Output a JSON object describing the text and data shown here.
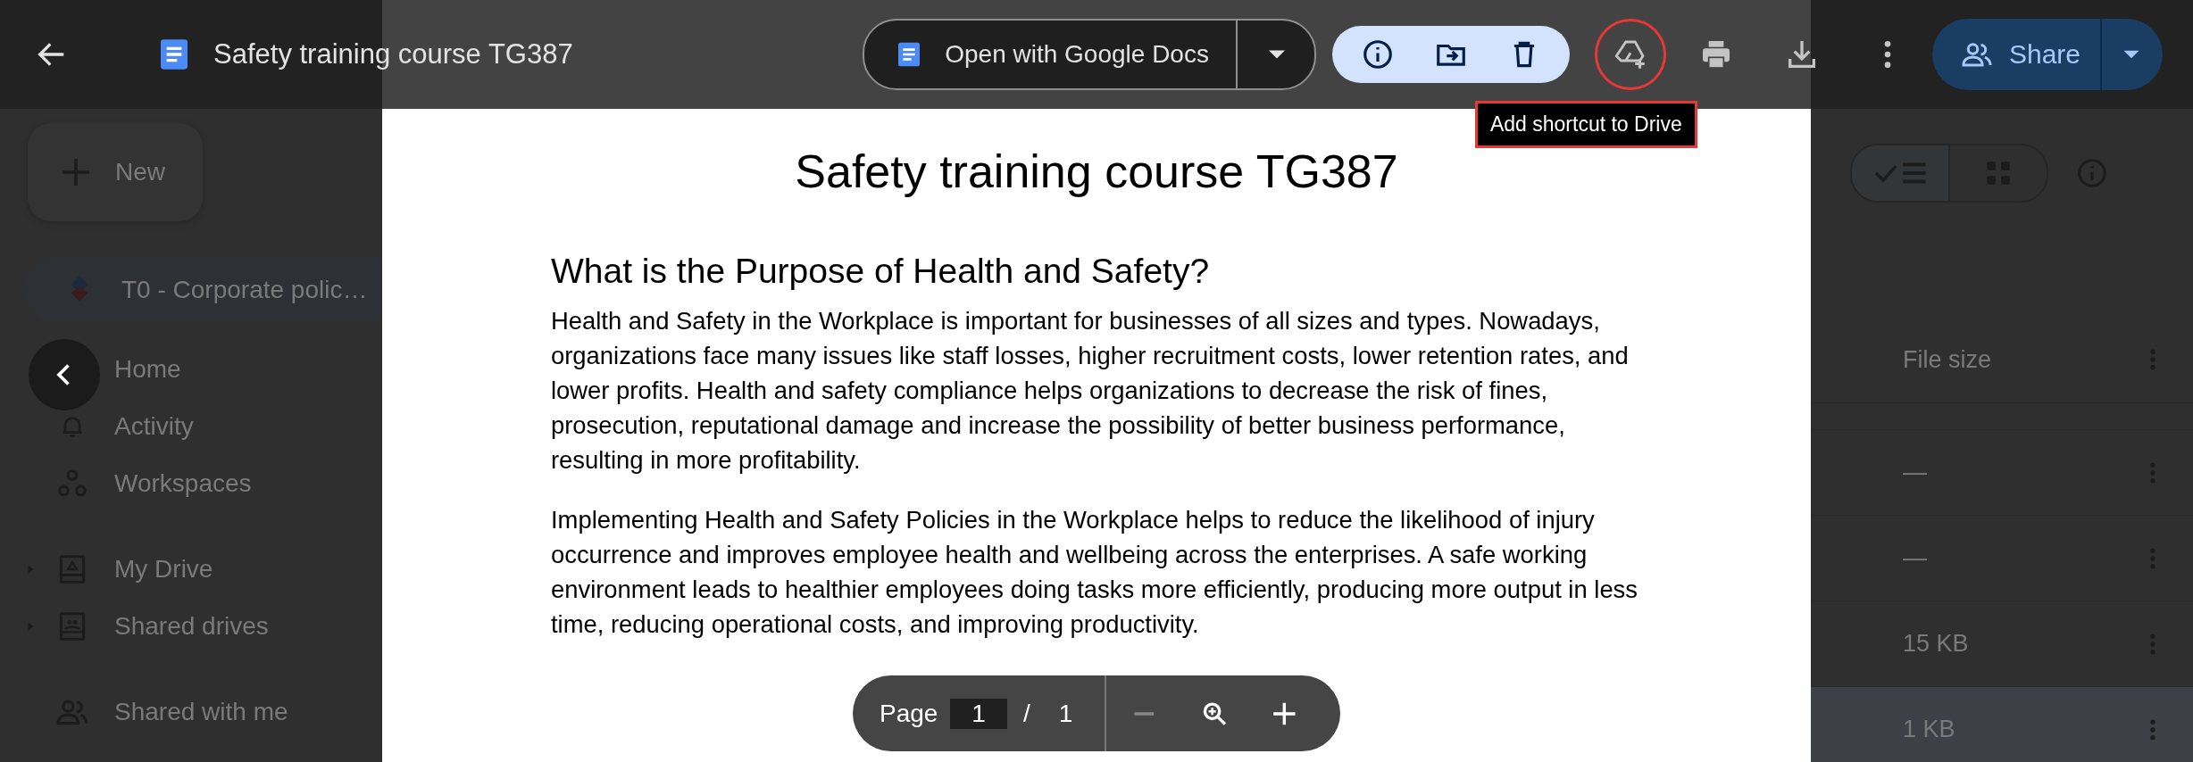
{
  "header": {
    "title": "Safety training course TG387",
    "open_with": "Open with Google Docs",
    "tooltip": "Add shortcut to Drive",
    "share": "Share"
  },
  "sidebar": {
    "new_button": "New",
    "pinned": "T0 - Corporate polic…",
    "items": [
      {
        "label": "Home",
        "kind": "home"
      },
      {
        "label": "Activity",
        "kind": "activity"
      },
      {
        "label": "Workspaces",
        "kind": "workspaces"
      },
      {
        "label": "My Drive",
        "kind": "drive",
        "expanded": false
      },
      {
        "label": "Shared drives",
        "kind": "shared-drives",
        "expanded": false
      },
      {
        "label": "Shared with me",
        "kind": "shared"
      }
    ]
  },
  "document": {
    "title": "Safety training course TG387",
    "heading": "What is the Purpose of Health and Safety?",
    "paragraphs": [
      "Health and Safety in the Workplace is important for businesses of all sizes and types. Nowadays, organizations face many issues like staff losses, higher recruitment costs, lower retention rates, and lower profits. Health and safety compliance helps organizations to decrease the risk of fines, prosecution, reputational damage and increase the possibility of better business performance, resulting in more profitability.",
      "Implementing Health and Safety Policies in the Workplace helps to reduce the likelihood of injury occurrence and improves employee health and wellbeing across the enterprises. A safe working environment leads to healthier employees doing tasks more efficiently, producing more output in less time, reducing operational costs, and improving productivity."
    ]
  },
  "page_controls": {
    "label": "Page",
    "current": "1",
    "separator": "/",
    "total": "1",
    "zoom_out_disabled": true
  },
  "file_list": {
    "column": "File size",
    "rows": [
      {
        "size": "—",
        "selected": false
      },
      {
        "size": "—",
        "selected": false
      },
      {
        "size": "15 KB",
        "selected": false
      },
      {
        "size": "1 KB",
        "selected": true
      }
    ]
  }
}
